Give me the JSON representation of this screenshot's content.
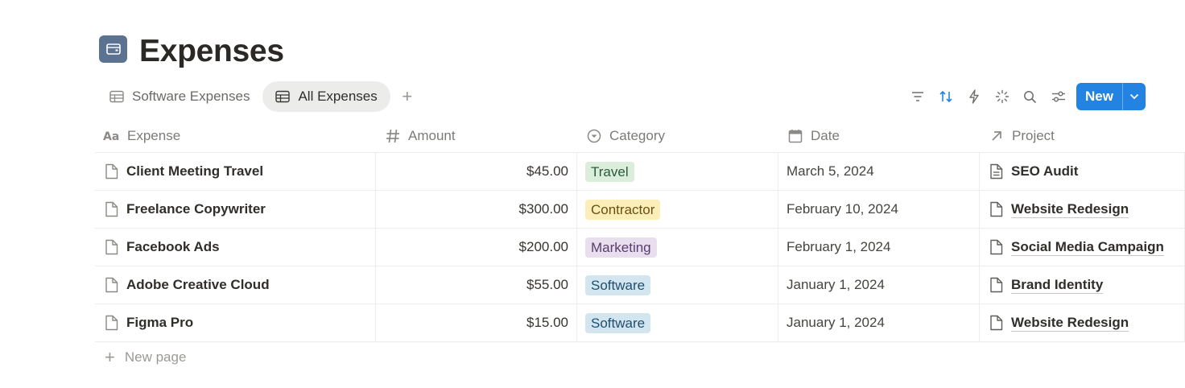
{
  "page": {
    "title": "Expenses",
    "icon": "wallet-icon",
    "icon_color": "#5b7391"
  },
  "views": {
    "tabs": [
      {
        "label": "Software Expenses",
        "icon": "table-icon",
        "active": false
      },
      {
        "label": "All Expenses",
        "icon": "table-icon",
        "active": true
      }
    ],
    "add_icon": "plus-icon"
  },
  "toolbar": {
    "icons": [
      "filter-icon",
      "sort-icon",
      "lightning-icon",
      "sparkle-icon",
      "search-icon",
      "settings-sliders-icon"
    ],
    "new_label": "New",
    "accent": "#2383e2"
  },
  "table": {
    "columns": [
      {
        "label": "Expense",
        "icon": "text-property-icon"
      },
      {
        "label": "Amount",
        "icon": "number-property-icon"
      },
      {
        "label": "Category",
        "icon": "select-property-icon"
      },
      {
        "label": "Date",
        "icon": "calendar-icon"
      },
      {
        "label": "Project",
        "icon": "relation-arrow-icon"
      }
    ],
    "rows": [
      {
        "expense": "Client Meeting Travel",
        "amount": "$45.00",
        "category": "Travel",
        "date": "March 5, 2024",
        "project": "SEO Audit",
        "project_link": false
      },
      {
        "expense": "Freelance Copywriter",
        "amount": "$300.00",
        "category": "Contractor",
        "date": "February 10, 2024",
        "project": "Website Redesign",
        "project_link": true
      },
      {
        "expense": "Facebook Ads",
        "amount": "$200.00",
        "category": "Marketing",
        "date": "February 1, 2024",
        "project": "Social Media Campaign",
        "project_link": true
      },
      {
        "expense": "Adobe Creative Cloud",
        "amount": "$55.00",
        "category": "Software",
        "date": "January 1, 2024",
        "project": "Brand Identity",
        "project_link": true
      },
      {
        "expense": "Figma Pro",
        "amount": "$15.00",
        "category": "Software",
        "date": "January 1, 2024",
        "project": "Website Redesign",
        "project_link": true
      }
    ],
    "category_colors": {
      "Travel": {
        "bg": "#dbeddb",
        "fg": "#2b5a3a"
      },
      "Contractor": {
        "bg": "#fbeeb8",
        "fg": "#6b4f12"
      },
      "Marketing": {
        "bg": "#e8deee",
        "fg": "#5a3d6e"
      },
      "Software": {
        "bg": "#d3e5ef",
        "fg": "#1f4f6e"
      }
    },
    "new_page_label": "New page"
  }
}
